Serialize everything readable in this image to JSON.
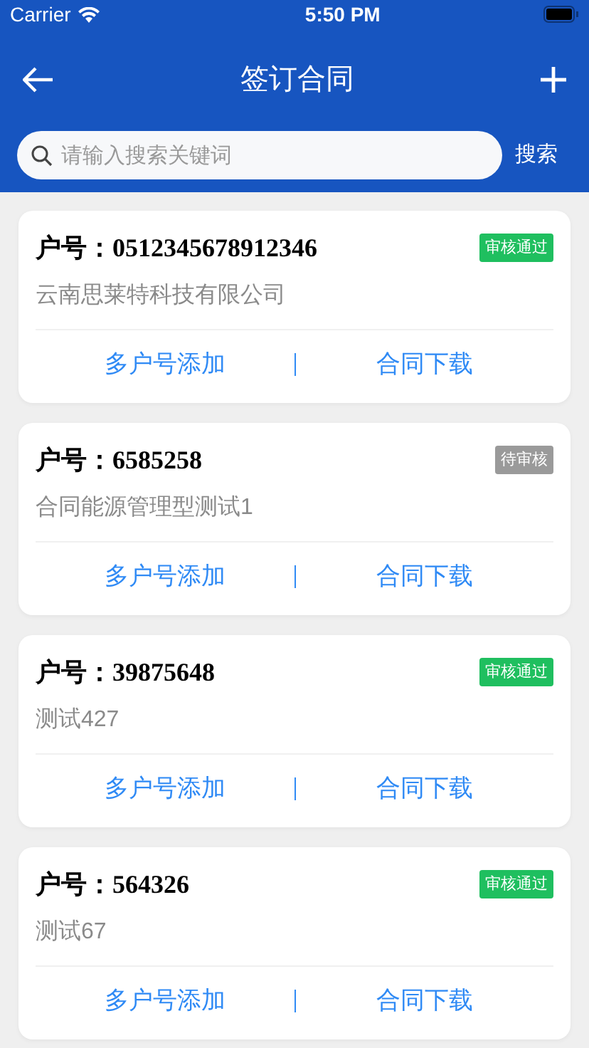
{
  "status_bar": {
    "carrier": "Carrier",
    "time": "5:50 PM"
  },
  "nav": {
    "title": "签订合同"
  },
  "search": {
    "placeholder": "请输入搜索关键词",
    "button": "搜索"
  },
  "cards": [
    {
      "label": "户号：",
      "account": "0512345678912346",
      "status": {
        "text": "审核通过",
        "color": "#1fbf5f"
      },
      "name": "云南思莱特科技有限公司",
      "actions": [
        "多户号添加",
        "合同下载"
      ]
    },
    {
      "label": "户号：",
      "account": "6585258",
      "status": {
        "text": "待审核",
        "color": "#9a9a9a"
      },
      "name": "合同能源管理型测试1",
      "actions": [
        "多户号添加",
        "合同下载"
      ]
    },
    {
      "label": "户号：",
      "account": "39875648",
      "status": {
        "text": "审核通过",
        "color": "#1fbf5f"
      },
      "name": "测试427",
      "actions": [
        "多户号添加",
        "合同下载"
      ]
    },
    {
      "label": "户号：",
      "account": "564326",
      "status": {
        "text": "审核通过",
        "color": "#1fbf5f"
      },
      "name": "测试67",
      "actions": [
        "多户号添加",
        "合同下载"
      ]
    }
  ]
}
